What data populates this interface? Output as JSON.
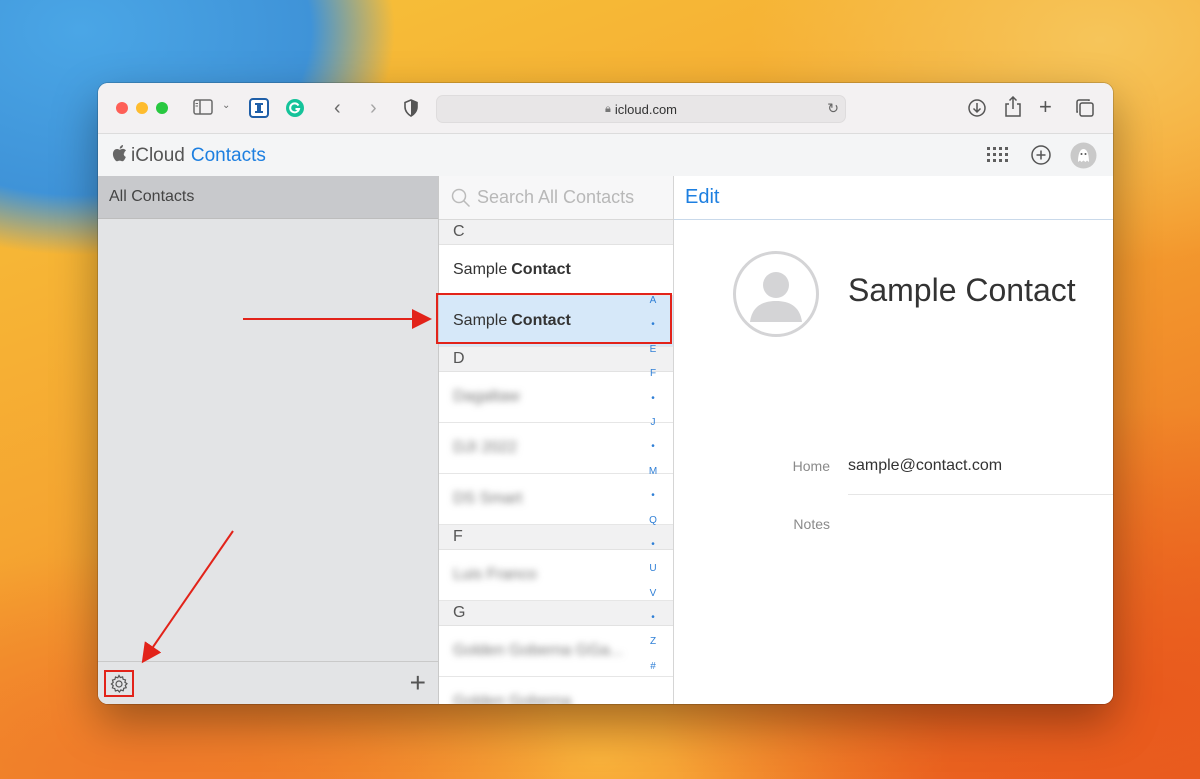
{
  "browser": {
    "url": "icloud.com"
  },
  "app": {
    "brand": "iCloud",
    "name": "Contacts"
  },
  "sidebar": {
    "all_contacts": "All Contacts"
  },
  "list": {
    "search_placeholder": "Search All Contacts",
    "sections": [
      {
        "letter": "C",
        "rows": [
          {
            "first": "Sample",
            "last": "Contact"
          },
          {
            "first": "Sample",
            "last": "Contact"
          }
        ]
      },
      {
        "letter": "D",
        "rows": [
          {
            "text": "Dagaltaw"
          },
          {
            "text": "DJI 2022"
          },
          {
            "text": "DS Smart"
          }
        ]
      },
      {
        "letter": "F",
        "rows": [
          {
            "text": "Luis Franco"
          }
        ]
      },
      {
        "letter": "G",
        "rows": [
          {
            "text": "Golden Goberna GGa..."
          },
          {
            "text": "Golden Goberna"
          }
        ]
      }
    ],
    "index": [
      "A",
      "•",
      "E",
      "F",
      "•",
      "J",
      "•",
      "M",
      "•",
      "Q",
      "•",
      "U",
      "V",
      "•",
      "Z",
      "#"
    ]
  },
  "detail": {
    "edit": "Edit",
    "name": "Sample Contact",
    "home_label": "Home",
    "home_value": "sample@contact.com",
    "notes_label": "Notes"
  },
  "colors": {
    "accent": "#1d7fe0",
    "annotation": "#e2231a",
    "selected_row": "#d6e8f9"
  }
}
